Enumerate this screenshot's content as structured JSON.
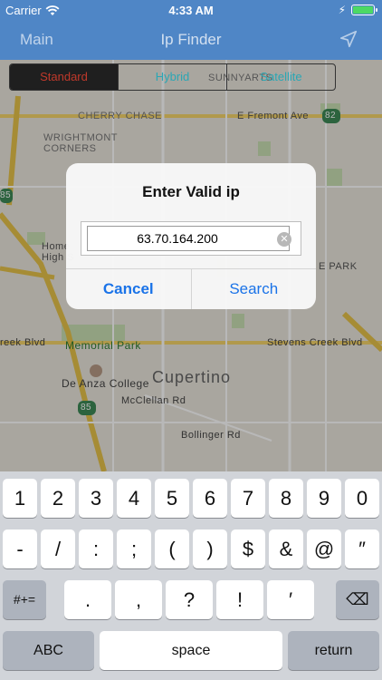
{
  "status": {
    "carrier": "Carrier",
    "time": "4:33 AM",
    "charge_glyph": "⚡"
  },
  "nav": {
    "back": "Main",
    "title": "Ip Finder",
    "locate_icon": "location-arrow-icon"
  },
  "segment": {
    "items": [
      "Standard",
      "Hybrid",
      "Satellite"
    ],
    "selected": "Standard"
  },
  "map_labels": {
    "cherry_chase": "CHERRY CHASE",
    "wrightmont": "WRIGHTMONT",
    "corners": "CORNERS",
    "fremont": "E Fremont Ave",
    "memorial_park": "Memorial Park",
    "cupertino": "Cupertino",
    "de_anza": "De Anza College",
    "mcclellan": "McClellan Rd",
    "stevens_creek": "Stevens Creek Blvd",
    "reek_blvd": "reek Blvd",
    "bollinger": "Bollinger Rd",
    "sunnyarts": "SUNNYARTS",
    "home": "Home",
    "high": "High S",
    "park": "E PARK",
    "hwy_82": "82",
    "hwy_85a": "85",
    "hwy_85b": "85"
  },
  "alert": {
    "title": "Enter Valid ip",
    "input_value": "63.70.164.200",
    "cancel": "Cancel",
    "search": "Search"
  },
  "keyboard": {
    "row1": [
      "1",
      "2",
      "3",
      "4",
      "5",
      "6",
      "7",
      "8",
      "9",
      "0"
    ],
    "row2": [
      "-",
      "/",
      ":",
      ";",
      "(",
      ")",
      "$",
      "&",
      "@",
      "″"
    ],
    "row3_left": "#+=",
    "row3": [
      ".",
      ",",
      "?",
      "!",
      "′"
    ],
    "row3_right": "⌫",
    "abc": "ABC",
    "space": "space",
    "return": "return"
  },
  "colors": {
    "nav_bar": "#4f86c6",
    "segment_tint": "#2aa7b5",
    "segment_selected_text": "#c0392b",
    "alert_button": "#1a73e8"
  }
}
